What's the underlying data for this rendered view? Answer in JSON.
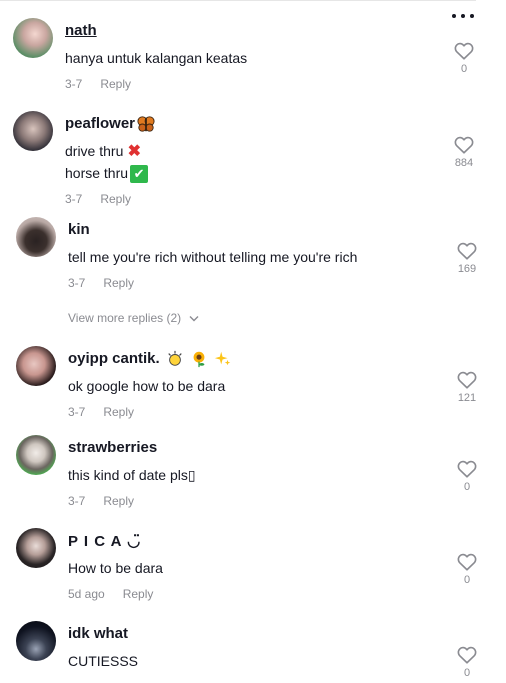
{
  "menu": {
    "icon": "more-dots-icon"
  },
  "comments": [
    {
      "username": "nath",
      "text": [
        "hanya untuk kalangan keatas"
      ],
      "date": "3-7",
      "reply_label": "Reply",
      "likes": "0"
    },
    {
      "username": "peaflower",
      "text": [
        "drive thru",
        "horse thru"
      ],
      "date": "3-7",
      "reply_label": "Reply",
      "likes": "884"
    },
    {
      "username": "kin",
      "text": [
        "tell me you're rich without telling me you're rich"
      ],
      "date": "3-7",
      "reply_label": "Reply",
      "likes": "169",
      "view_more": "View more replies (2)"
    },
    {
      "username": "oyipp cantik.",
      "text": [
        "ok google how to be dara"
      ],
      "date": "3-7",
      "reply_label": "Reply",
      "likes": "121"
    },
    {
      "username": "strawberries",
      "text": [
        "this kind of date pls▯"
      ],
      "date": "3-7",
      "reply_label": "Reply",
      "likes": "0"
    },
    {
      "username": "P I C A ◡̈",
      "text": [
        "How to be dara"
      ],
      "date": "5d ago",
      "reply_label": "Reply",
      "likes": "0"
    },
    {
      "username": "idk what",
      "text": [
        "CUTIESSS"
      ],
      "date": "",
      "reply_label": "",
      "likes": "0"
    }
  ],
  "emojis": {
    "butterfly": "butterfly-icon",
    "cross": "✖",
    "check": "✔",
    "sun": "sun-icon",
    "sunflower": "sunflower-icon",
    "sparkles": "sparkles-icon"
  }
}
